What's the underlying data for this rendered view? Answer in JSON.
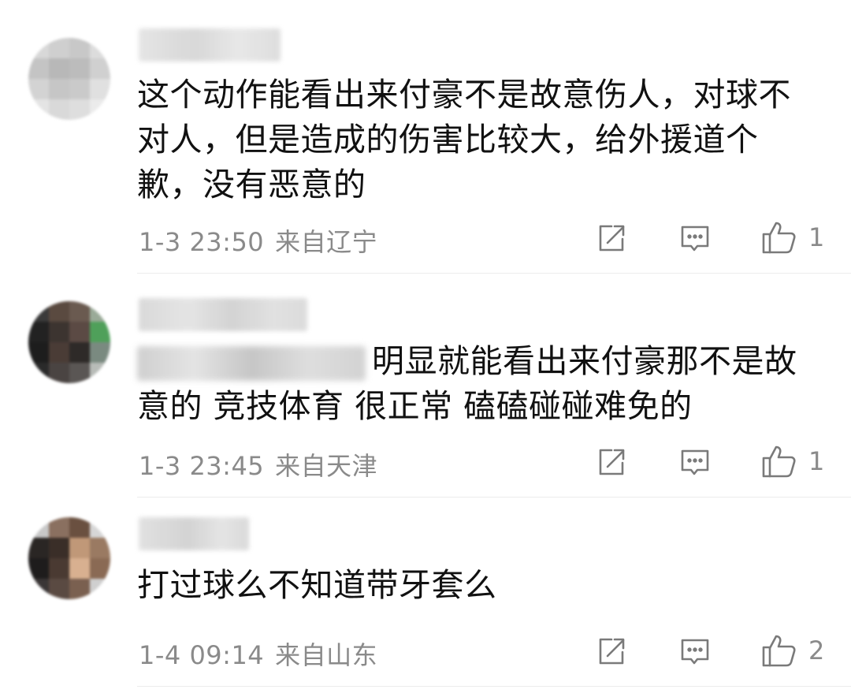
{
  "comments": [
    {
      "text": "这个动作能看出来付豪不是故意伤人，对球不对人，但是造成的伤害比较大，给外援道个歉，没有恶意的",
      "text_before": "",
      "time": "1-3 23:50",
      "location": "来自辽宁",
      "likes": "1"
    },
    {
      "text": "明显就能看出来付豪那不是故意的  竞技体育 很正常 磕磕碰碰难免的",
      "text_before": "",
      "time": "1-3 23:45",
      "location": "来自天津",
      "likes": "1"
    },
    {
      "text": "打过球么不知道带牙套么",
      "text_before": "",
      "time": "1-4 09:14",
      "location": "来自山东",
      "likes": "2"
    }
  ],
  "icons": {
    "forward": "share-edit-icon",
    "reply": "comment-icon",
    "like": "thumbs-up-icon"
  },
  "colors": {
    "meta_text": "#8a8a8a",
    "icon_stroke": "#7a7a7a",
    "divider": "#ececec"
  }
}
